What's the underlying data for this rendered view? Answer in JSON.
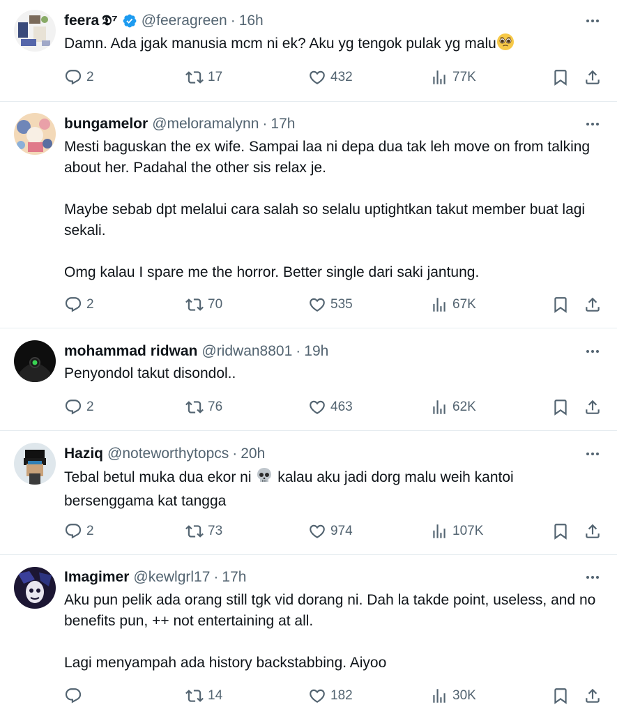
{
  "tweets": [
    {
      "name": "feera",
      "name_extra": "𝕯⁷",
      "verified": true,
      "handle": "@feeragreen",
      "time": "16h",
      "lines": [
        "Damn. Ada jgak manusia mcm ni ek? Aku yg tengok pulak yg malu"
      ],
      "emoji": "pleading-face",
      "replies": "2",
      "retweets": "17",
      "likes": "432",
      "views": "77K"
    },
    {
      "name": "bungamelor",
      "handle": "@meloramalynn",
      "time": "17h",
      "paragraphs": [
        "Mesti baguskan the ex wife. Sampai laa ni depa dua tak leh move on from talking about her. Padahal the other sis relax je.",
        "Maybe sebab dpt melalui cara salah so selalu uptightkan takut member buat lagi sekali.",
        "Omg kalau I spare me the horror. Better single dari saki jantung."
      ],
      "replies": "2",
      "retweets": "70",
      "likes": "535",
      "views": "67K"
    },
    {
      "name": "mohammad ridwan",
      "handle": "@ridwan8801",
      "time": "19h",
      "text": "Penyondol takut disondol..",
      "replies": "2",
      "retweets": "76",
      "likes": "463",
      "views": "62K"
    },
    {
      "name": "Haziq",
      "handle": "@noteworthytopcs",
      "time": "20h",
      "text_before": "Tebal betul muka dua ekor ni",
      "emoji": "skull",
      "text_after": "kalau aku jadi dorg malu weih kantoi bersenggama kat tangga",
      "replies": "2",
      "retweets": "73",
      "likes": "974",
      "views": "107K"
    },
    {
      "name": "Imagimer",
      "handle": "@kewlgrl17",
      "time": "17h",
      "paragraphs": [
        "Aku pun pelik ada orang still tgk vid dorang ni. Dah la takde point, useless, and no benefits pun, ++ not entertaining at all.",
        "Lagi menyampah ada history backstabbing. Aiyoo"
      ],
      "replies": "",
      "retweets": "14",
      "likes": "182",
      "views": "30K"
    }
  ],
  "icons": {
    "reply": "reply-icon",
    "retweet": "retweet-icon",
    "like": "like-icon",
    "views": "views-icon",
    "bookmark": "bookmark-icon",
    "share": "share-icon",
    "more": "more-icon",
    "verified": "verified-badge-icon"
  },
  "colors": {
    "text": "#0f1419",
    "secondary": "#536471",
    "verified": "#1d9bf0",
    "divider": "#e6ecf0"
  }
}
